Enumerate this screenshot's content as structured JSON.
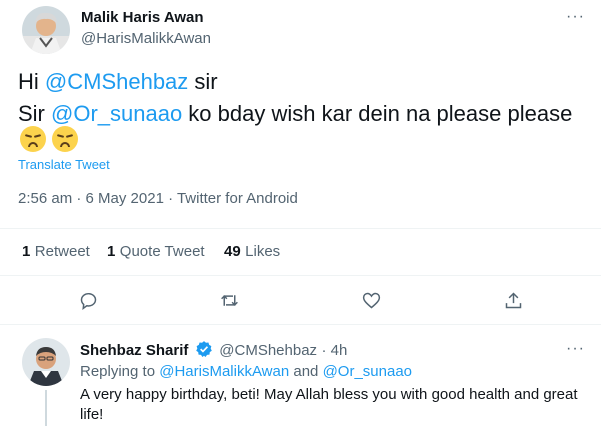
{
  "tweet": {
    "author_name": "Malik Haris Awan",
    "author_handle": "@HarisMalikkAwan",
    "more": "···",
    "text": {
      "line1_prefix": "Hi ",
      "line1_mention": "@CMShehbaz",
      "line1_suffix": " sir",
      "line2_prefix": "Sir ",
      "line2_mention": "@Or_sunaao",
      "line2_suffix": " ko bday wish kar dein na please please"
    },
    "emojis": [
      "disappointed-face",
      "disappointed-face"
    ],
    "translate_label": "Translate Tweet",
    "meta": "2:56 am · 6 May 2021 · Twitter for Android"
  },
  "stats": {
    "retweets_count": "1",
    "retweets_label": "Retweet",
    "quotes_count": "1",
    "quotes_label": "Quote Tweet",
    "likes_count": "49",
    "likes_label": "Likes"
  },
  "actions": {
    "icons": [
      "reply-icon",
      "retweet-icon",
      "like-icon",
      "share-icon"
    ]
  },
  "reply": {
    "author_name": "Shehbaz Sharif",
    "author_handle": "@CMShehbaz",
    "time": "· 4h",
    "more": "···",
    "replying_prefix": "Replying to ",
    "replying_user1": "@HarisMalikkAwan",
    "replying_and": " and ",
    "replying_user2": "@Or_sunaao",
    "text_line1": "A very happy birthday, beti! May Allah bless you with good health and great",
    "text_line2": "life!"
  },
  "colors": {
    "accent": "#1d9bf0",
    "secondary_text": "#536471",
    "primary_text": "#0f1419",
    "divider": "#eff3f4"
  }
}
